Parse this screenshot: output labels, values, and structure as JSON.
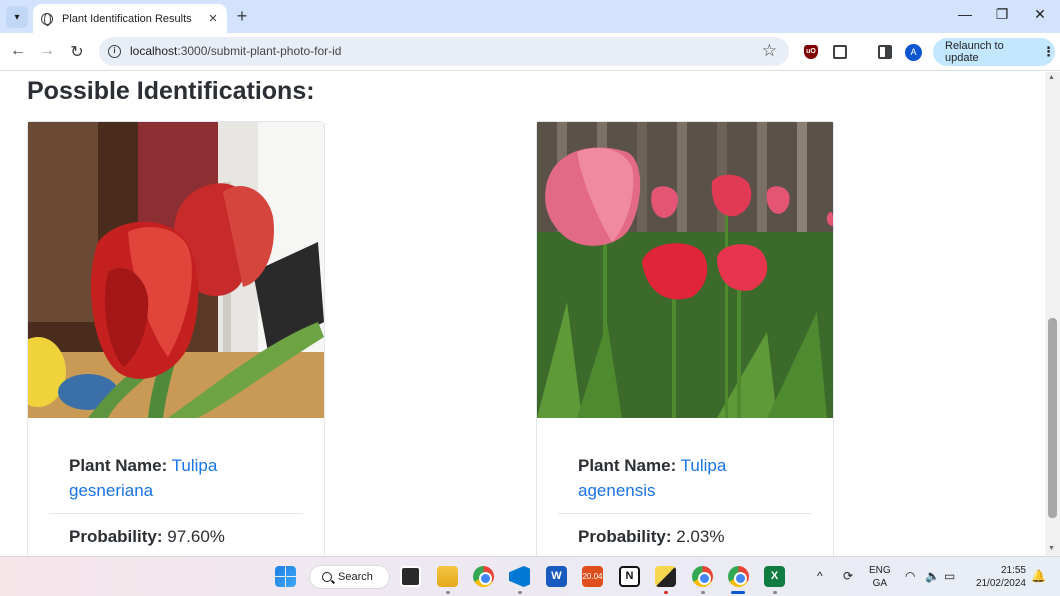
{
  "browser": {
    "tab_title": "Plant Identification Results",
    "url_host": "localhost",
    "url_rest": ":3000/submit-plant-photo-for-id",
    "profile_initial": "A",
    "relaunch_label": "Relaunch to update",
    "ublock_label": "uO"
  },
  "page": {
    "heading": "Possible Identifications:",
    "name_label": "Plant Name:",
    "probability_label": "Probability:",
    "results": [
      {
        "name_line1": "Tulipa",
        "name_line2": "gesneriana",
        "probability": "97.60%"
      },
      {
        "name_line1": "Tulipa",
        "name_line2": "agenensis",
        "probability": "2.03%"
      }
    ]
  },
  "taskbar": {
    "search_label": "Search",
    "word_letter": "W",
    "excel_letter": "X",
    "notion_letter": "N",
    "office_label": "20.04",
    "lang_line1": "ENG",
    "lang_line2": "GA",
    "time": "21:55",
    "date": "21/02/2024"
  },
  "colors": {
    "link": "#1a73e8",
    "heading": "#2b2f33",
    "tabstrip": "#d3e3fd",
    "relaunch_bg": "#c2e7ff"
  }
}
